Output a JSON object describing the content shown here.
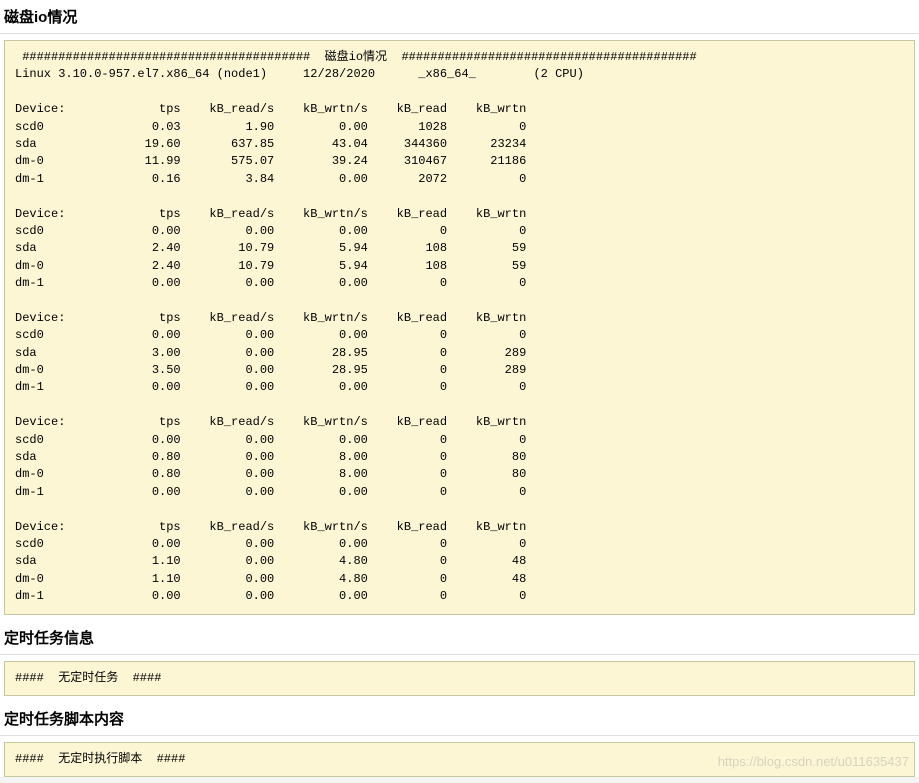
{
  "sections": {
    "disk_io": {
      "title": "磁盘io情况",
      "banner_label": "磁盘io情况",
      "hash_left": "########################################",
      "hash_right": "#########################################",
      "linux_line": {
        "kernel": "Linux 3.10.0-957.el7.x86_64 (node1)",
        "date": "12/28/2020",
        "arch": "_x86_64_",
        "cpu": "(2 CPU)"
      },
      "headers": [
        "Device:",
        "tps",
        "kB_read/s",
        "kB_wrtn/s",
        "kB_read",
        "kB_wrtn"
      ],
      "blocks": [
        [
          {
            "dev": "scd0",
            "tps": "0.03",
            "kbr": "1.90",
            "kbw": "0.00",
            "kr": "1028",
            "kw": "0"
          },
          {
            "dev": "sda",
            "tps": "19.60",
            "kbr": "637.85",
            "kbw": "43.04",
            "kr": "344360",
            "kw": "23234"
          },
          {
            "dev": "dm-0",
            "tps": "11.99",
            "kbr": "575.07",
            "kbw": "39.24",
            "kr": "310467",
            "kw": "21186"
          },
          {
            "dev": "dm-1",
            "tps": "0.16",
            "kbr": "3.84",
            "kbw": "0.00",
            "kr": "2072",
            "kw": "0"
          }
        ],
        [
          {
            "dev": "scd0",
            "tps": "0.00",
            "kbr": "0.00",
            "kbw": "0.00",
            "kr": "0",
            "kw": "0"
          },
          {
            "dev": "sda",
            "tps": "2.40",
            "kbr": "10.79",
            "kbw": "5.94",
            "kr": "108",
            "kw": "59"
          },
          {
            "dev": "dm-0",
            "tps": "2.40",
            "kbr": "10.79",
            "kbw": "5.94",
            "kr": "108",
            "kw": "59"
          },
          {
            "dev": "dm-1",
            "tps": "0.00",
            "kbr": "0.00",
            "kbw": "0.00",
            "kr": "0",
            "kw": "0"
          }
        ],
        [
          {
            "dev": "scd0",
            "tps": "0.00",
            "kbr": "0.00",
            "kbw": "0.00",
            "kr": "0",
            "kw": "0"
          },
          {
            "dev": "sda",
            "tps": "3.00",
            "kbr": "0.00",
            "kbw": "28.95",
            "kr": "0",
            "kw": "289"
          },
          {
            "dev": "dm-0",
            "tps": "3.50",
            "kbr": "0.00",
            "kbw": "28.95",
            "kr": "0",
            "kw": "289"
          },
          {
            "dev": "dm-1",
            "tps": "0.00",
            "kbr": "0.00",
            "kbw": "0.00",
            "kr": "0",
            "kw": "0"
          }
        ],
        [
          {
            "dev": "scd0",
            "tps": "0.00",
            "kbr": "0.00",
            "kbw": "0.00",
            "kr": "0",
            "kw": "0"
          },
          {
            "dev": "sda",
            "tps": "0.80",
            "kbr": "0.00",
            "kbw": "8.00",
            "kr": "0",
            "kw": "80"
          },
          {
            "dev": "dm-0",
            "tps": "0.80",
            "kbr": "0.00",
            "kbw": "8.00",
            "kr": "0",
            "kw": "80"
          },
          {
            "dev": "dm-1",
            "tps": "0.00",
            "kbr": "0.00",
            "kbw": "0.00",
            "kr": "0",
            "kw": "0"
          }
        ],
        [
          {
            "dev": "scd0",
            "tps": "0.00",
            "kbr": "0.00",
            "kbw": "0.00",
            "kr": "0",
            "kw": "0"
          },
          {
            "dev": "sda",
            "tps": "1.10",
            "kbr": "0.00",
            "kbw": "4.80",
            "kr": "0",
            "kw": "48"
          },
          {
            "dev": "dm-0",
            "tps": "1.10",
            "kbr": "0.00",
            "kbw": "4.80",
            "kr": "0",
            "kw": "48"
          },
          {
            "dev": "dm-1",
            "tps": "0.00",
            "kbr": "0.00",
            "kbw": "0.00",
            "kr": "0",
            "kw": "0"
          }
        ]
      ]
    },
    "cron": {
      "title": "定时任务信息",
      "content": "####  无定时任务  ####"
    },
    "cron_scripts": {
      "title": "定时任务脚本内容",
      "content": "####  无定时执行脚本  ####"
    }
  },
  "watermark": "https://blog.csdn.net/u011635437"
}
